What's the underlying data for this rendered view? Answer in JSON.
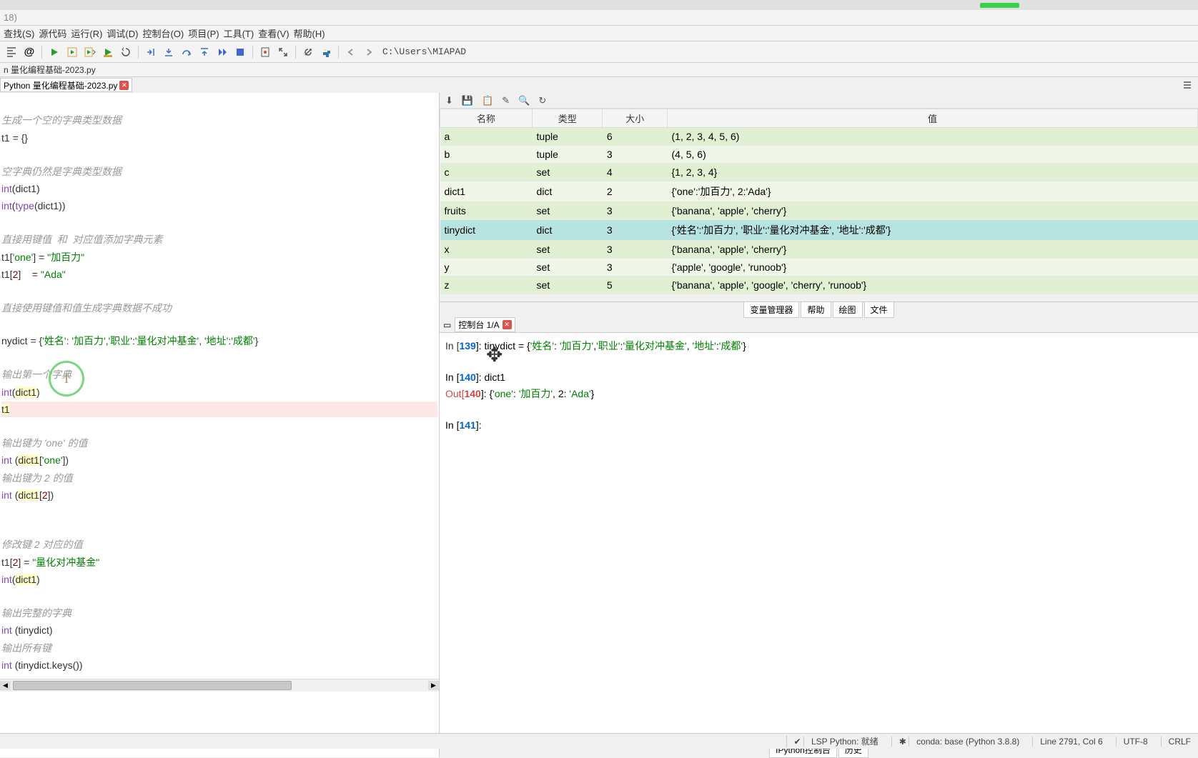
{
  "titlebar": {
    "partial": "18)"
  },
  "menu": [
    "查找(S)",
    "源代码",
    "运行(R)",
    "调试(D)",
    "控制台(O)",
    "项目(P)",
    "工具(T)",
    "查看(V)",
    "帮助(H)"
  ],
  "toolbar_path": "C:\\Users\\MIAPAD",
  "breadcrumb": "n 量化编程基础-2023.py",
  "filetab": "Python 量化编程基础-2023.py",
  "var_headers": [
    "名称",
    "类型",
    "大小",
    "值"
  ],
  "vars": [
    {
      "name": "a",
      "type": "tuple",
      "size": "6",
      "val": "(1, 2, 3, 4, 5, 6)",
      "cls": "r0"
    },
    {
      "name": "b",
      "type": "tuple",
      "size": "3",
      "val": "(4, 5, 6)",
      "cls": "r1"
    },
    {
      "name": "c",
      "type": "set",
      "size": "4",
      "val": "{1, 2, 3, 4}",
      "cls": "r0"
    },
    {
      "name": "dict1",
      "type": "dict",
      "size": "2",
      "val": "{'one':'加百力', 2:'Ada'}",
      "cls": "r1"
    },
    {
      "name": "fruits",
      "type": "set",
      "size": "3",
      "val": "{'banana', 'apple', 'cherry'}",
      "cls": "r0"
    },
    {
      "name": "tinydict",
      "type": "dict",
      "size": "3",
      "val": "{'姓名':'加百力', '职业':'量化对冲基金', '地址':'成都'}",
      "cls": "hl"
    },
    {
      "name": "x",
      "type": "set",
      "size": "3",
      "val": "{'banana', 'apple', 'cherry'}",
      "cls": "r0"
    },
    {
      "name": "y",
      "type": "set",
      "size": "3",
      "val": "{'apple', 'google', 'runoob'}",
      "cls": "r1"
    },
    {
      "name": "z",
      "type": "set",
      "size": "5",
      "val": "{'banana', 'apple', 'google', 'cherry', 'runoob'}",
      "cls": "r0"
    }
  ],
  "right_tabs": [
    "变量管理器",
    "帮助",
    "绘图",
    "文件"
  ],
  "console_tab": "控制台 1/A",
  "console_bottom_tabs": [
    "IPython控制台",
    "历史"
  ],
  "console": {
    "l1_in": "In [",
    "l1_num": "139",
    "l1_suf": "]: ",
    "l1_code_a": "tinydict = {",
    "l1_s1": "'姓名'",
    "l1_c": ": ",
    "l1_s2": "'加百力'",
    "l1_cm": ",",
    "l1_s3": "'职业'",
    "l1_c2": ":",
    "l1_s4": "'量化对冲基金'",
    "l1_cm2": ", ",
    "l1_s5": "'地址'",
    "l1_c3": ":",
    "l1_s6": "'成都'",
    "l1_end": "}",
    "l2_in": "In [",
    "l2_num": "140",
    "l2_suf": "]: dict1",
    "l3_out": "Out[",
    "l3_num": "140",
    "l3_suf": "]: {",
    "l3_s1": "'one'",
    "l3_c": ": ",
    "l3_s2": "'加百力'",
    "l3_cm": ", 2: ",
    "l3_s3": "'Ada'",
    "l3_end": "}",
    "l4_in": "In [",
    "l4_num": "141",
    "l4_suf": "]:"
  },
  "status": {
    "lsp": "LSP Python: 就绪",
    "conda": "conda: base (Python 3.8.8)",
    "pos": "Line 2791, Col 6",
    "enc": "UTF-8",
    "eol": "CRLF"
  },
  "code": {
    "c1": "生成一个空的字典类型数据",
    "l1a": "t1 = {}",
    "c2": "空字典仍然是字典类型数据",
    "l2a": "int",
    "l2b": "(dict1)",
    "l3a": "int",
    "l3b": "(",
    "l3c": "type",
    "l3d": "(dict1))",
    "c3": "直接用键值  和  对应值添加字典元素",
    "l4a": "t1[",
    "l4b": "'one'",
    "l4c": "] = ",
    "l4d": "\"加百力\"",
    "l5a": "t1[",
    "l5b": "2",
    "l5c": "]    = ",
    "l5d": "\"Ada\"",
    "c4": "直接使用键值和值生成字典数据不成功",
    "l6a": "nydict = {",
    "l6b": "'姓名'",
    "l6c": ": ",
    "l6d": "'加百力'",
    "l6e": ",",
    "l6f": "'职业'",
    "l6g": ":",
    "l6h": "'量化对冲基金'",
    "l6i": ", ",
    "l6j": "'地址'",
    "l6k": ":",
    "l6l": "'成都'",
    "l6m": "}",
    "c5": "输出第一个字典",
    "l7a": "int",
    "l7b": "(",
    "l7c": "dict1",
    "l7d": ")",
    "l8": "t1",
    "c6": "输出键为 'one' 的值",
    "l9a": "int ",
    "l9b": "(",
    "l9c": "dict1",
    "l9d": "[",
    "l9e": "'one'",
    "l9f": "])",
    "c7": "输出键为 2 的值",
    "l10a": "int ",
    "l10b": "(",
    "l10c": "dict1",
    "l10d": "[",
    "l10e": "2",
    "l10f": "])",
    "c8": "修改键 2 对应的值",
    "l11a": "t1[",
    "l11b": "2",
    "l11c": "] = ",
    "l11d": "\"量化对冲基金\"",
    "l12a": "int",
    "l12b": "(",
    "l12c": "dict1",
    "l12d": ")",
    "c9": "输出完整的字典",
    "l13a": "int ",
    "l13b": "(tinydict)",
    "c10": "输出所有键",
    "l14a": "int ",
    "l14b": "(tinydict.keys())"
  }
}
